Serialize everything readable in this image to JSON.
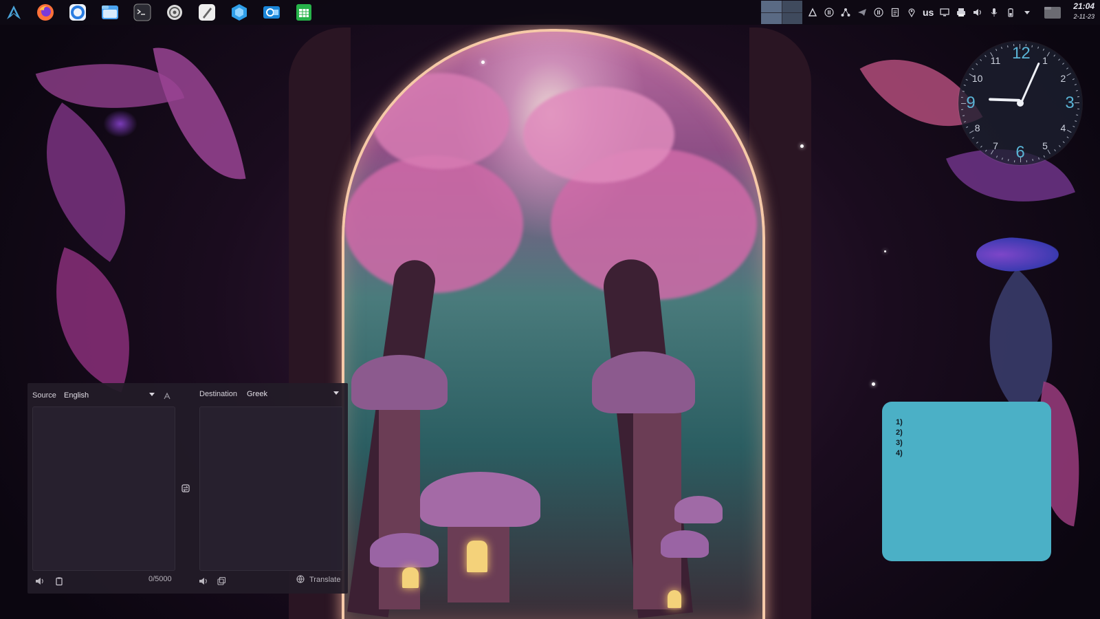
{
  "panel": {
    "launcher_icon": "arch-launcher-icon",
    "tasks": [
      {
        "name": "firefox-icon",
        "color": "#ff7139"
      },
      {
        "name": "browser-icon",
        "color": "#2a7de1"
      },
      {
        "name": "file-manager-icon",
        "color": "#4aa3f0"
      },
      {
        "name": "terminal-icon",
        "color": "#2b2b33"
      },
      {
        "name": "settings-icon",
        "color": "#dcdcdc"
      },
      {
        "name": "text-editor-icon",
        "color": "#eeeeee"
      },
      {
        "name": "software-center-icon",
        "color": "#2f9ee8"
      },
      {
        "name": "mail-icon",
        "color": "#1b86d8"
      },
      {
        "name": "spreadsheet-icon",
        "color": "#27b34a"
      }
    ],
    "keyboard_layout": "us",
    "time": "21:04",
    "date": "2-11-23"
  },
  "analog_clock": {
    "numbers": [
      "12",
      "1",
      "2",
      "3",
      "4",
      "5",
      "6",
      "7",
      "8",
      "9",
      "10",
      "11"
    ],
    "hour": 9,
    "minute": 4
  },
  "sticky_note": {
    "lines": [
      "1)",
      "2)",
      "3)",
      "4)"
    ],
    "color": "#4bb0c6"
  },
  "translator": {
    "source_label": "Source",
    "source_language": "English",
    "destination_label": "Destination",
    "destination_language": "Greek",
    "char_count": "0/5000",
    "translate_button": "Translate",
    "source_text": "",
    "destination_text": ""
  }
}
